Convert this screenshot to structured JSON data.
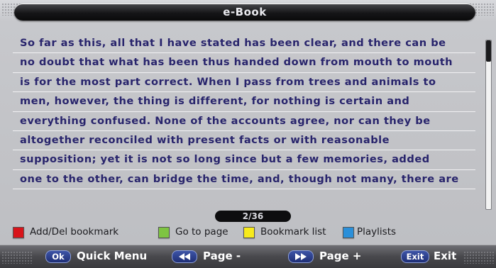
{
  "window": {
    "title": "e-Book"
  },
  "reader": {
    "lines": [
      "So far as this, all that I have stated has been clear, and there can be",
      "no doubt that what has been thus handed down from mouth to mouth",
      "is for the most part correct. When I pass from trees and animals to",
      "men, however, the thing is different, for nothing is certain and",
      "everything confused. None of the accounts agree, nor can they be",
      "altogether reconciled with present facts or with reasonable",
      "supposition; yet it is not so long since but a few memories, added",
      "one to the other, can bridge the time, and, though not many, there are"
    ],
    "page_indicator": "2/36"
  },
  "legend": {
    "red_label": "Add/Del bookmark",
    "green_label": "Go to page",
    "yellow_label": "Bookmark list",
    "blue_label": "Playlists",
    "colors": {
      "red": "#d8141a",
      "green": "#7ec442",
      "yellow": "#f7ea1b",
      "blue": "#2a8fd9"
    }
  },
  "bottom_keys": {
    "ok_key": "Ok",
    "ok_label": "Quick Menu",
    "rewind_icon": "rewind-icon",
    "page_minus_label": "Page -",
    "forward_icon": "fast-forward-icon",
    "page_plus_label": "Page +",
    "exit_key": "Exit",
    "exit_label": "Exit"
  }
}
